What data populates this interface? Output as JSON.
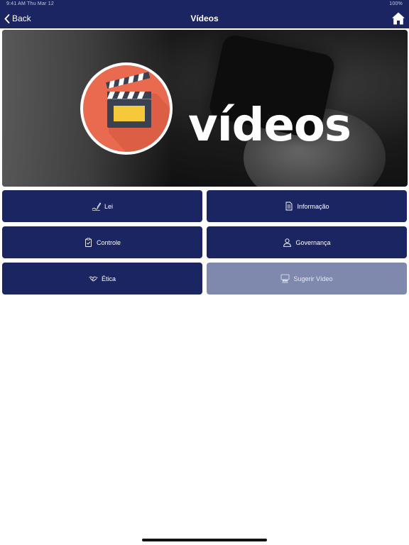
{
  "status": {
    "time": "9:41 AM",
    "date": "Thu Mar 12",
    "battery": "100%"
  },
  "nav": {
    "back_label": "Back",
    "title": "Vídeos",
    "home_icon": "home-icon"
  },
  "banner": {
    "text": "vídeos",
    "icon": "clapperboard-icon",
    "circle_color": "#e96a4f"
  },
  "buttons": [
    {
      "label": "Lei",
      "icon": "signature-icon",
      "enabled": true
    },
    {
      "label": "Informação",
      "icon": "document-icon",
      "enabled": true
    },
    {
      "label": "Controle",
      "icon": "clipboard-check-icon",
      "enabled": true
    },
    {
      "label": "Governança",
      "icon": "user-icon",
      "enabled": true
    },
    {
      "label": "Ética",
      "icon": "handshake-icon",
      "enabled": true
    },
    {
      "label": "Sugerir Vídeo",
      "icon": "people-group-icon",
      "enabled": false
    }
  ],
  "colors": {
    "primary": "#1b2561",
    "disabled": "#7f88ad",
    "background": "#ffffff"
  }
}
